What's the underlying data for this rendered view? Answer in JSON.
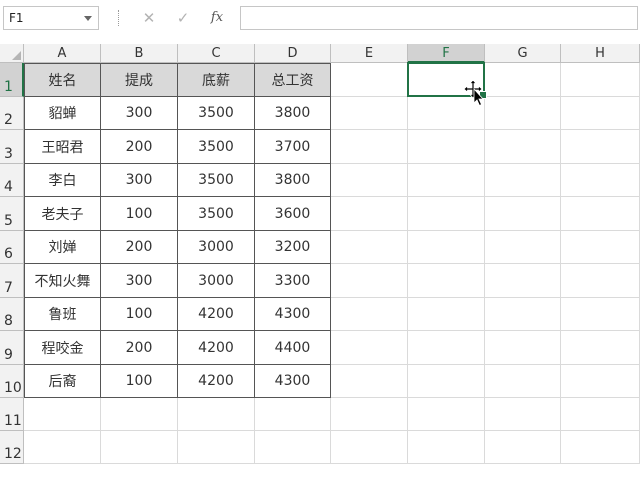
{
  "formula_bar": {
    "name_box": "F1",
    "cancel_icon": "✕",
    "enter_icon": "✓",
    "function_label": "fx",
    "formula_value": ""
  },
  "columns": [
    "A",
    "B",
    "C",
    "D",
    "E",
    "F",
    "G",
    "H"
  ],
  "rows": [
    "1",
    "2",
    "3",
    "4",
    "5",
    "6",
    "7",
    "8",
    "9",
    "10",
    "11",
    "12"
  ],
  "selected_cell": "F1",
  "table": {
    "headers": [
      "姓名",
      "提成",
      "底薪",
      "总工资"
    ],
    "rows": [
      [
        "貂蝉",
        "300",
        "3500",
        "3800"
      ],
      [
        "王昭君",
        "200",
        "3500",
        "3700"
      ],
      [
        "李白",
        "300",
        "3500",
        "3800"
      ],
      [
        "老夫子",
        "100",
        "3500",
        "3600"
      ],
      [
        "刘婵",
        "200",
        "3000",
        "3200"
      ],
      [
        "不知火舞",
        "300",
        "3000",
        "3300"
      ],
      [
        "鲁班",
        "100",
        "4200",
        "4300"
      ],
      [
        "程咬金",
        "200",
        "4200",
        "4400"
      ],
      [
        "后裔",
        "100",
        "4200",
        "4300"
      ]
    ]
  },
  "colors": {
    "accent": "#217346",
    "header_fill": "#d9d9d9",
    "gridline": "#dadada"
  },
  "icons": {
    "cursor": "move-cursor-icon"
  }
}
